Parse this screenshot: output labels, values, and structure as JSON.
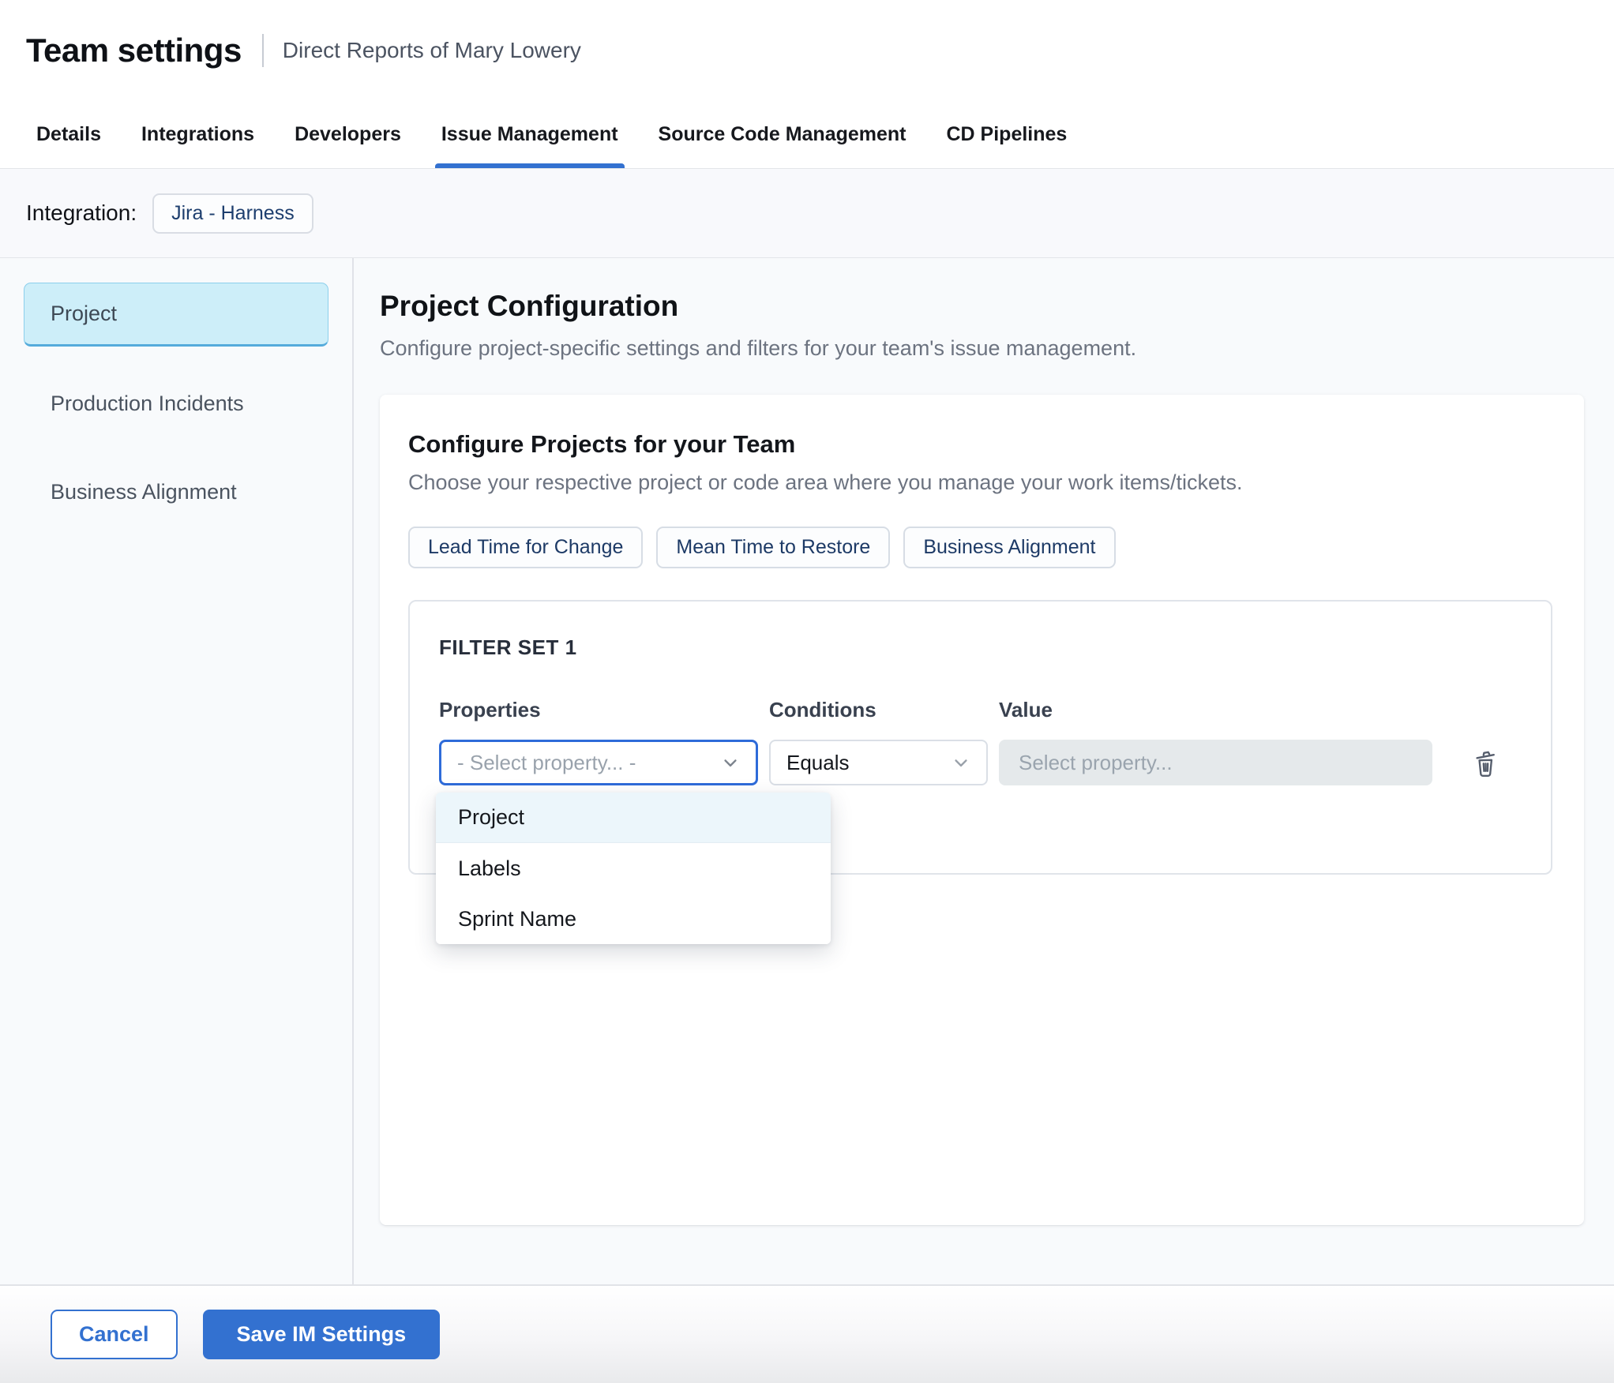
{
  "header": {
    "title": "Team settings",
    "subtitle": "Direct Reports of Mary Lowery"
  },
  "tabs": [
    {
      "label": "Details",
      "active": false
    },
    {
      "label": "Integrations",
      "active": false
    },
    {
      "label": "Developers",
      "active": false
    },
    {
      "label": "Issue Management",
      "active": true
    },
    {
      "label": "Source Code Management",
      "active": false
    },
    {
      "label": "CD Pipelines",
      "active": false
    }
  ],
  "integration": {
    "label": "Integration:",
    "chip": "Jira - Harness"
  },
  "sidebar": {
    "items": [
      {
        "label": "Project",
        "selected": true
      },
      {
        "label": "Production Incidents",
        "selected": false
      },
      {
        "label": "Business Alignment",
        "selected": false
      }
    ]
  },
  "main": {
    "title": "Project Configuration",
    "description": "Configure project-specific settings and filters for your team's issue management.",
    "card": {
      "title": "Configure Projects for your Team",
      "subtitle": "Choose your respective project or code area where you manage your work items/tickets.",
      "chips": [
        {
          "label": "Lead Time for Change"
        },
        {
          "label": "Mean Time to Restore"
        },
        {
          "label": "Business Alignment"
        }
      ],
      "filter_set": {
        "title": "FILTER SET 1",
        "columns": {
          "properties": "Properties",
          "conditions": "Conditions",
          "value": "Value"
        },
        "properties_placeholder": "- Select property... -",
        "conditions_value": "Equals",
        "value_placeholder": "Select property...",
        "dropdown_options": [
          {
            "label": "Project",
            "highlighted": true
          },
          {
            "label": "Labels",
            "highlighted": false
          },
          {
            "label": "Sprint Name",
            "highlighted": false
          }
        ]
      }
    }
  },
  "footer": {
    "cancel_label": "Cancel",
    "save_label": "Save IM Settings"
  },
  "colors": {
    "accent_blue": "#3371D0",
    "focus_border": "#2E6BD9",
    "selected_sidebar_bg": "#CDEEF9",
    "selected_sidebar_border": "#55ABDB",
    "dropdown_highlight": "#ECF6FB",
    "chip_text": "#1D3A66",
    "disabled_input_bg": "#E5E9EB"
  }
}
